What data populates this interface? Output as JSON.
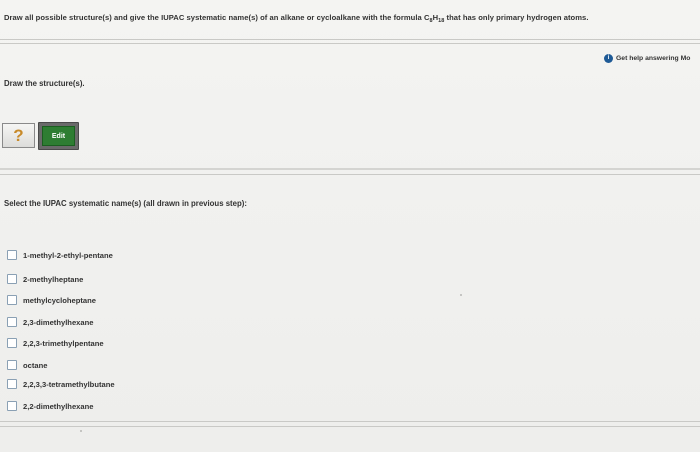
{
  "question": {
    "prefix": "Draw all possible structure(s) and give the IUPAC systematic name(s) of an alkane or cycloalkane with the formula C",
    "sub1": "8",
    "mid": "H",
    "sub2": "18",
    "suffix": " that has only primary hydrogen atoms."
  },
  "help": {
    "icon": "info-icon",
    "label": "Get help answering Mo"
  },
  "draw_section": {
    "label": "Draw the structure(s)."
  },
  "structure_placeholder": {
    "glyph": "?",
    "icon": "question-mark-icon"
  },
  "edit_button": {
    "label": "Edit",
    "color": "#2e7d32"
  },
  "select_section": {
    "label": "Select the IUPAC systematic name(s) (all drawn in previous step):"
  },
  "options": [
    "1-methyl-2-ethyl-pentane",
    "2-methylheptane",
    "methylcycloheptane",
    "2,3-dimethylhexane",
    "2,2,3-trimethylpentane",
    "octane",
    "2,2,3,3-tetramethylbutane",
    "2,2-dimethylhexane"
  ]
}
